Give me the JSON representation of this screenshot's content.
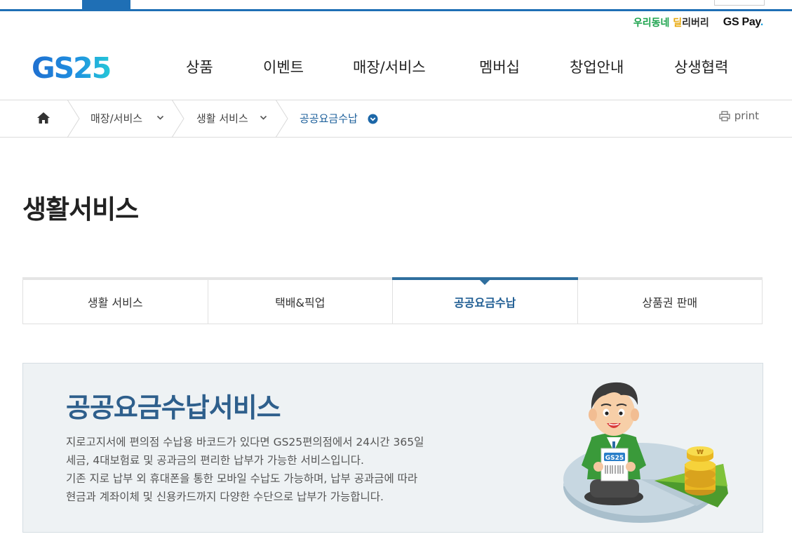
{
  "header": {
    "logo_text": "GS25",
    "utility": {
      "delivery_label_part1": "우리동네 ",
      "delivery_label_part2": "딜",
      "delivery_label_part3": "리버리",
      "gspay_label": "GS Pay",
      "gspay_dot": "."
    },
    "nav": [
      "상품",
      "이벤트",
      "매장/서비스",
      "멤버십",
      "창업안내",
      "상생협력"
    ]
  },
  "breadcrumb": {
    "level1": "매장/서비스",
    "level2": "생활 서비스",
    "level3": "공공요금수납",
    "print_label": "print"
  },
  "page_title": "생활서비스",
  "tabs": [
    {
      "label": "생활 서비스",
      "active": false
    },
    {
      "label": "택배&픽업",
      "active": false
    },
    {
      "label": "공공요금수납",
      "active": true
    },
    {
      "label": "상품권 판매",
      "active": false
    }
  ],
  "banner": {
    "title": "공공요금수납서비스",
    "lines": [
      "지로고지서에 편의점 수납용 바코드가 있다면 GS25편의점에서 24시간 365일",
      "세금, 4대보험료 및 공과금의 편리한 납부가 가능한 서비스입니다.",
      "기존 지로 납부 외 휴대폰을 통한 모바일 수납도 가능하며, 납부 공과금에 따라",
      "현금과 계좌이체 및 신용카드까지 다양한 수단으로 납부가 가능합니다."
    ],
    "illustration_badge": "GS25"
  },
  "colors": {
    "brand_blue": "#1f6fb5",
    "active_tab": "#1f5d93",
    "banner_title": "#2e5f8c",
    "banner_bg": "#eef2f4"
  }
}
